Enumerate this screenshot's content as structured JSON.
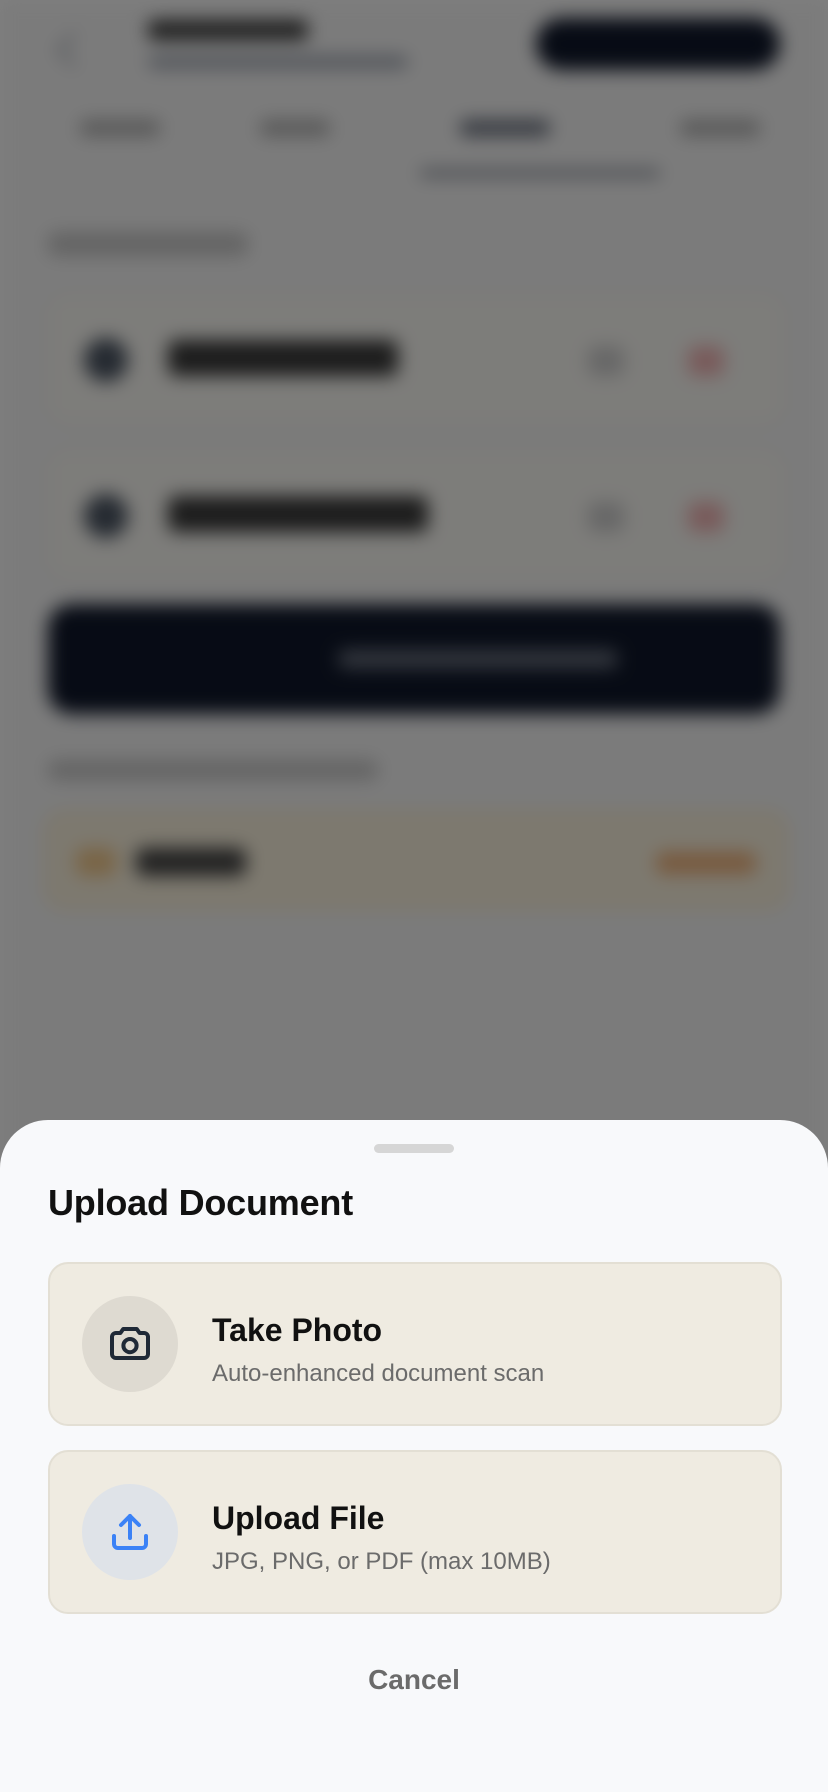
{
  "sheet": {
    "title": "Upload Document",
    "options": [
      {
        "icon": "camera-icon",
        "title": "Take Photo",
        "subtitle": "Auto-enhanced document scan"
      },
      {
        "icon": "upload-icon",
        "title": "Upload File",
        "subtitle": "JPG, PNG, or PDF (max 10MB)"
      }
    ],
    "cancel_label": "Cancel"
  },
  "colors": {
    "sheet_background": "#f8f9fb",
    "option_background": "#efebe1",
    "upload_icon_accent": "#3b82f6",
    "camera_icon_stroke": "#1f2937"
  }
}
